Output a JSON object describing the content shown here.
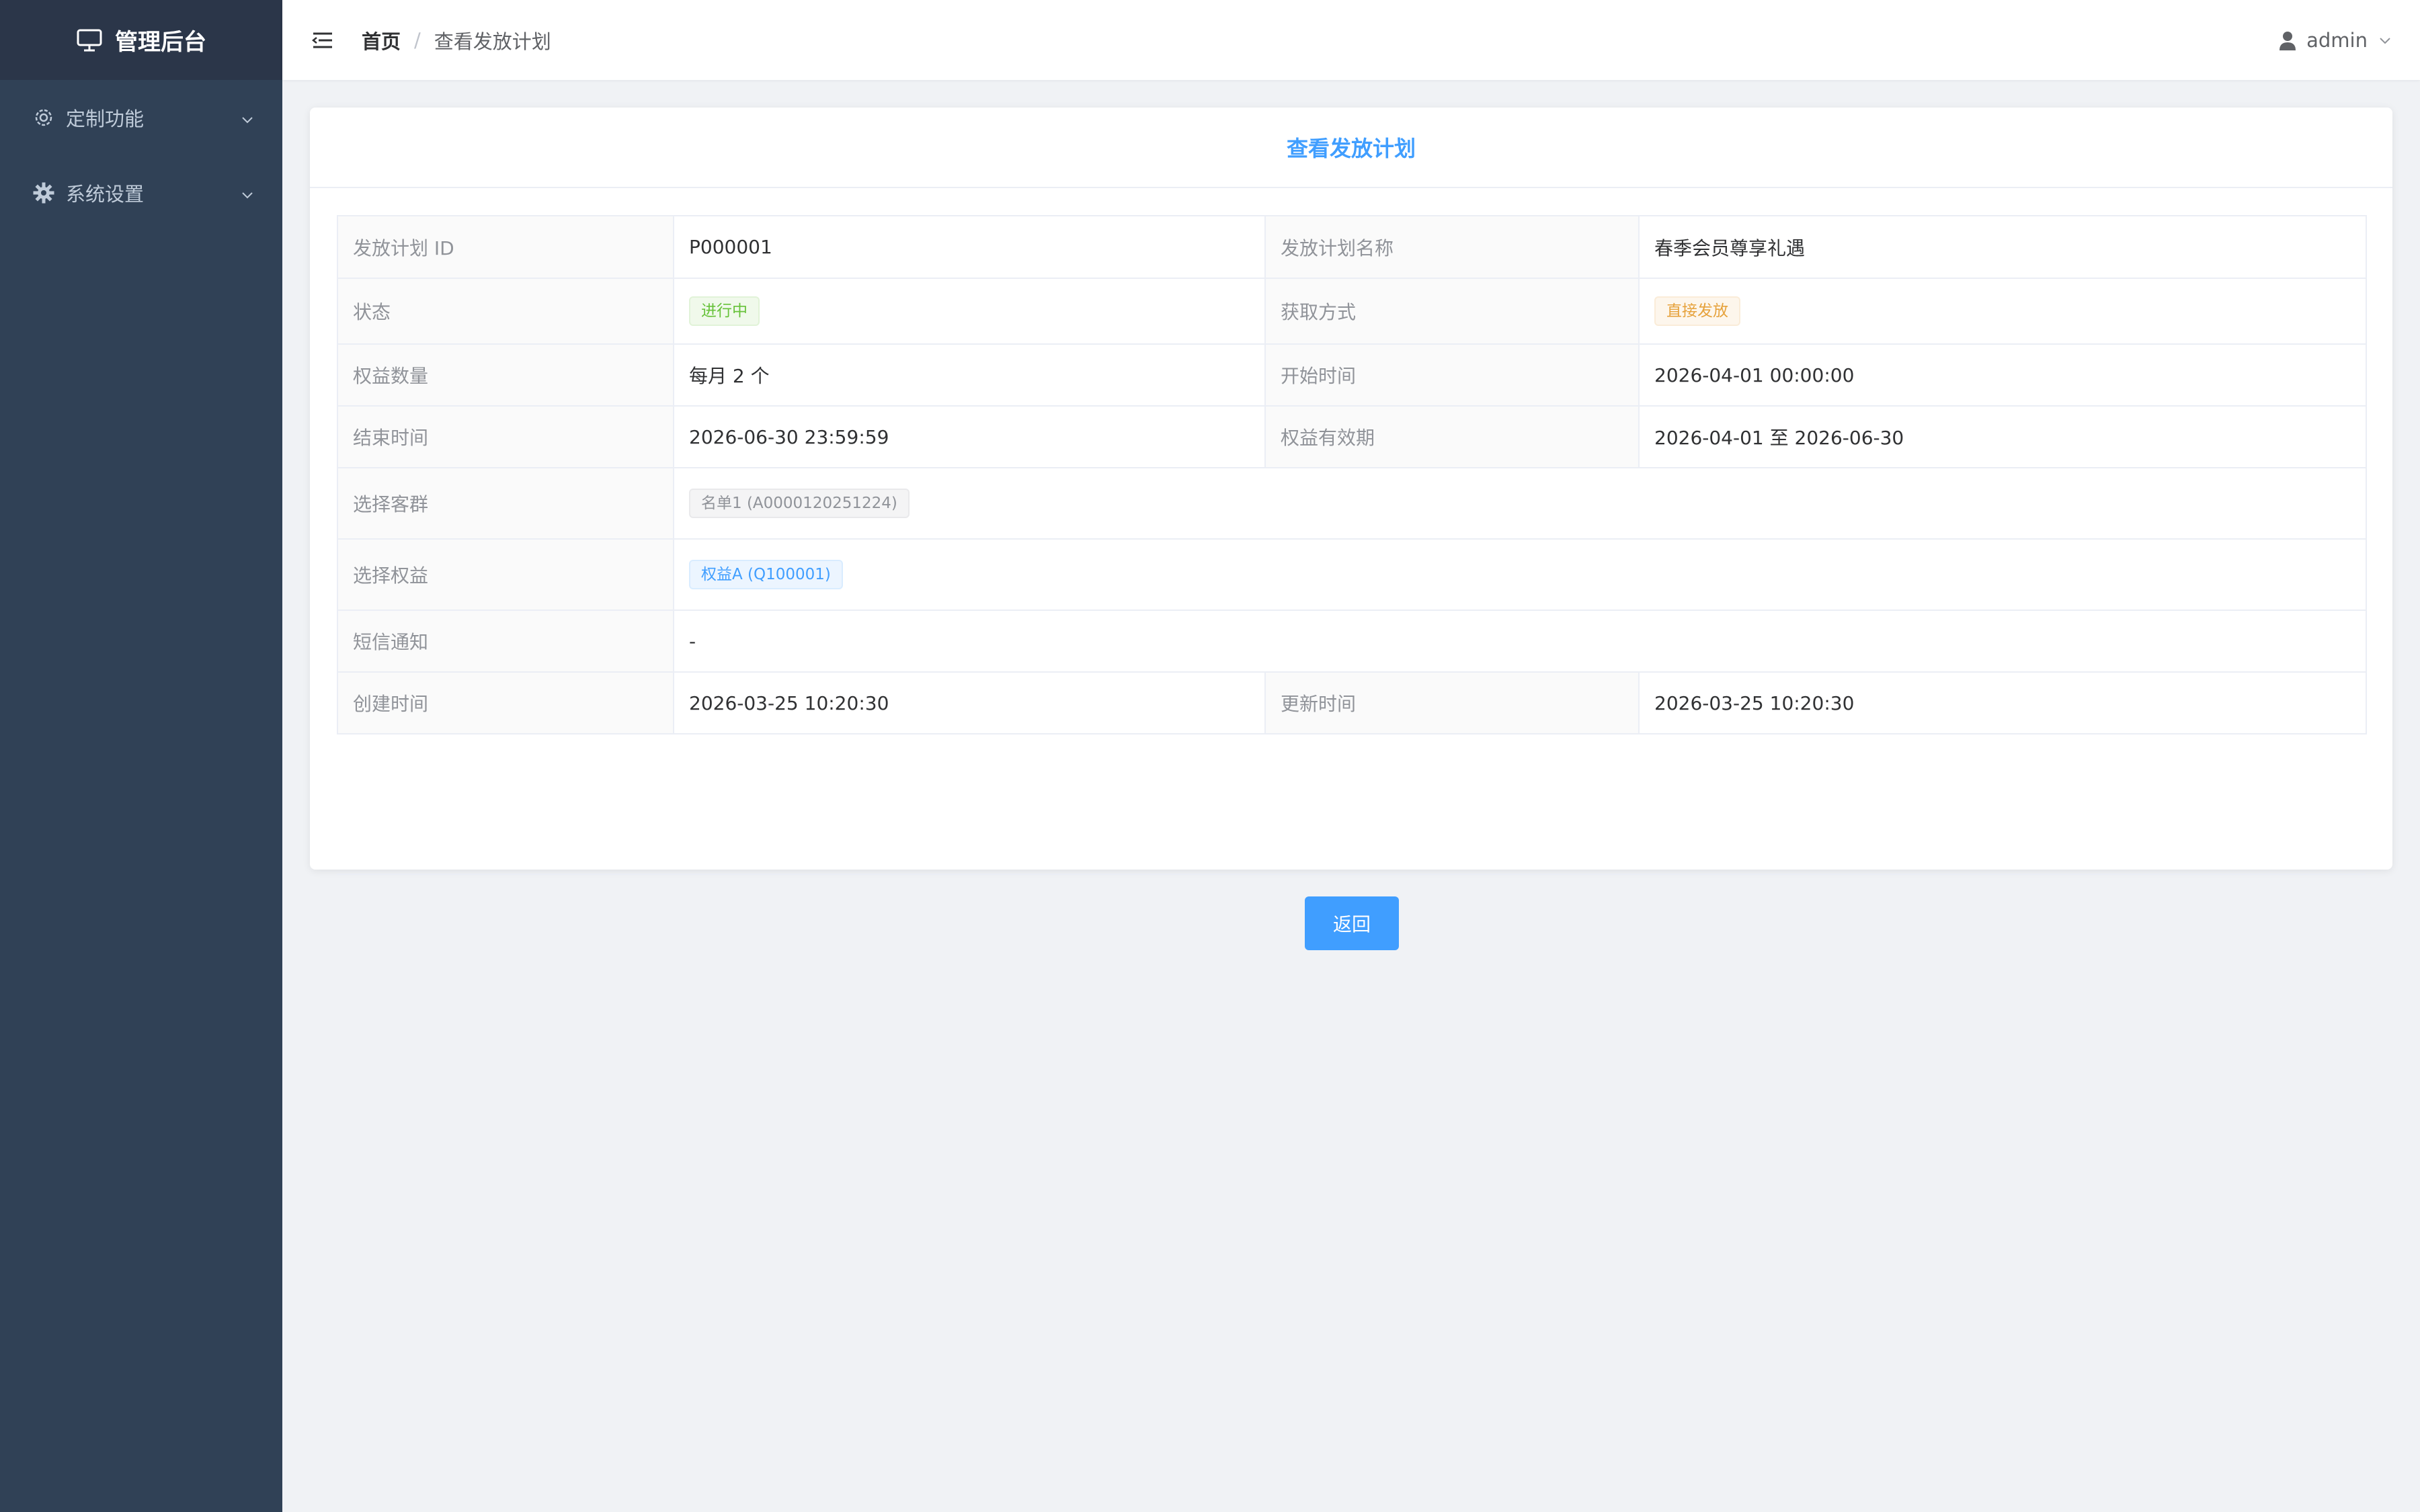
{
  "app": {
    "title": "管理后台"
  },
  "sidebar": {
    "items": [
      {
        "label": "定制功能",
        "icon": "gear-outline-icon"
      },
      {
        "label": "系统设置",
        "icon": "gear-icon"
      }
    ]
  },
  "header": {
    "breadcrumb": {
      "home": "首页",
      "separator": "/",
      "current": "查看发放计划"
    },
    "user": "admin"
  },
  "card": {
    "title": "查看发放计划",
    "rows": {
      "plan_id": {
        "label": "发放计划 ID",
        "value": "P000001"
      },
      "plan_name": {
        "label": "发放计划名称",
        "value": "春季会员尊享礼遇"
      },
      "status": {
        "label": "状态",
        "value": "进行中"
      },
      "acquire": {
        "label": "获取方式",
        "value": "直接发放"
      },
      "quantity": {
        "label": "权益数量",
        "value": "每月 2 个"
      },
      "start": {
        "label": "开始时间",
        "value": "2026-04-01 00:00:00"
      },
      "end": {
        "label": "结束时间",
        "value": "2026-06-30 23:59:59"
      },
      "validity": {
        "label": "权益有效期",
        "value": "2026-04-01 至 2026-06-30"
      },
      "audience": {
        "label": "选择客群",
        "value": "名单1 (A0000120251224)"
      },
      "benefit": {
        "label": "选择权益",
        "value": "权益A (Q100001)"
      },
      "sms": {
        "label": "短信通知",
        "value": "-"
      },
      "created": {
        "label": "创建时间",
        "value": "2026-03-25 10:20:30"
      },
      "updated": {
        "label": "更新时间",
        "value": "2026-03-25 10:20:30"
      }
    },
    "back_label": "返回"
  },
  "colors": {
    "sidebar_bg": "#304156",
    "logo_bg": "#2b3649",
    "primary": "#409eff",
    "success": "#67c23a",
    "warning": "#e6a23c"
  }
}
